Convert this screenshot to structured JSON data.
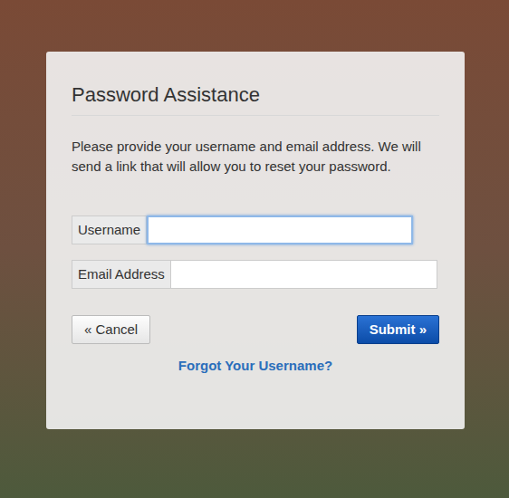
{
  "dialog": {
    "title": "Password Assistance",
    "description": "Please provide your username and email address. We will send a link that will allow you to reset your password.",
    "fields": [
      {
        "label": "Username",
        "value": "",
        "focused": true
      },
      {
        "label": "Email Address",
        "value": "",
        "focused": false
      }
    ],
    "buttons": {
      "cancel": "« Cancel",
      "submit": "Submit »"
    },
    "link": "Forgot Your Username?"
  }
}
